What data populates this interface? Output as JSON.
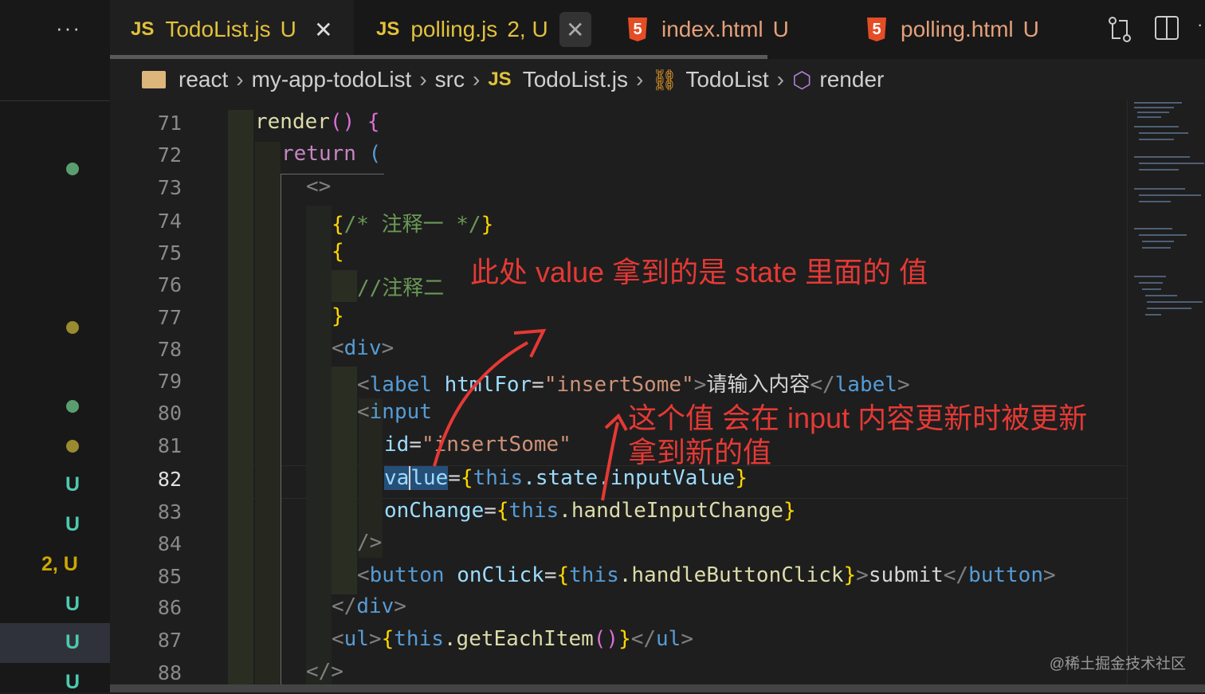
{
  "sidebar": {
    "more_label": "···",
    "badges": [
      "U",
      "U",
      "2, U",
      "U",
      "U",
      "U"
    ]
  },
  "tabs": [
    {
      "icon": "JS",
      "name": "TodoList.js",
      "status": "U",
      "close": "✕"
    },
    {
      "icon": "JS",
      "name": "polling.js",
      "status": "2, U",
      "close": "✕"
    },
    {
      "icon": "5",
      "name": "index.html",
      "status": "U"
    },
    {
      "icon": "5",
      "name": "polling.html",
      "status": "U"
    }
  ],
  "breadcrumb": {
    "items": [
      "react",
      "my-app-todoList",
      "src",
      "TodoList.js",
      "TodoList",
      "render"
    ],
    "js_icon": "JS",
    "separator": "›"
  },
  "editor": {
    "current_line": 82,
    "line_numbers": [
      "71",
      "72",
      "73",
      "74",
      "75",
      "76",
      "77",
      "78",
      "79",
      "80",
      "81",
      "82",
      "83",
      "84",
      "85",
      "86",
      "87",
      "88"
    ],
    "lines": {
      "l71_fn": "render",
      "l71_parens": "()",
      "l71_brace": " {",
      "l72_kw": "return",
      "l72_paren": " (",
      "l73": "<>",
      "l74_open": "{",
      "l74_comment": "/* 注释一 */",
      "l74_close": "}",
      "l75": "{",
      "l76": "//注释二",
      "l77": "}",
      "l78_open": "<",
      "l78_tag": "div",
      "l78_close": ">",
      "l79_open": "<",
      "l79_tag": "label",
      "l79_attr": " htmlFor",
      "l79_eq": "=",
      "l79_str": "\"insertSome\"",
      "l79_gt": ">",
      "l79_text": "请输入内容",
      "l79_endopen": "</",
      "l79_endtag": "label",
      "l79_endgt": ">",
      "l80_open": "<",
      "l80_tag": "input",
      "l81_attr": "id",
      "l81_eq": "=",
      "l81_str": "\"insertSome\"",
      "l82_attr_a": "va",
      "l82_attr_b": "lue",
      "l82_eq": "=",
      "l82_ob": "{",
      "l82_this": "this",
      "l82_rest": ".state.inputValue",
      "l82_cb": "}",
      "l83_attr": "onChange",
      "l83_eq": "=",
      "l83_ob": "{",
      "l83_this": "this",
      "l83_rest": ".handleInputChange",
      "l83_cb": "}",
      "l84": "/>",
      "l85_open": "<",
      "l85_tag": "button",
      "l85_attr": " onClick",
      "l85_eq": "=",
      "l85_ob": "{",
      "l85_this": "this",
      "l85_rest": ".handleButtonClick",
      "l85_cb": "}",
      "l85_gt": ">",
      "l85_text": "submit",
      "l85_endopen": "</",
      "l85_endtag": "button",
      "l85_endgt": ">",
      "l86_open": "</",
      "l86_tag": "div",
      "l86_close": ">",
      "l87_open": "<",
      "l87_tag": "ul",
      "l87_gt": ">",
      "l87_ob": "{",
      "l87_this": "this",
      "l87_rest": ".getEachItem",
      "l87_parens": "()",
      "l87_cb": "}",
      "l87_endopen": "</",
      "l87_endtag": "ul",
      "l87_endgt": ">",
      "l88": "</>"
    }
  },
  "annotations": {
    "note1": "此处 value 拿到的是 state 里面的 值",
    "note2_line1": "这个值 会在 input 内容更新时被更新",
    "note2_line2": "拿到新的值",
    "annotation_color": "#e53935"
  },
  "watermark": "@稀土掘金技术社区",
  "colors": {
    "git_untracked": "#73c991",
    "git_warning": "#cca700",
    "js_icon": "#e2c13c",
    "html_icon": "#e44d26"
  }
}
